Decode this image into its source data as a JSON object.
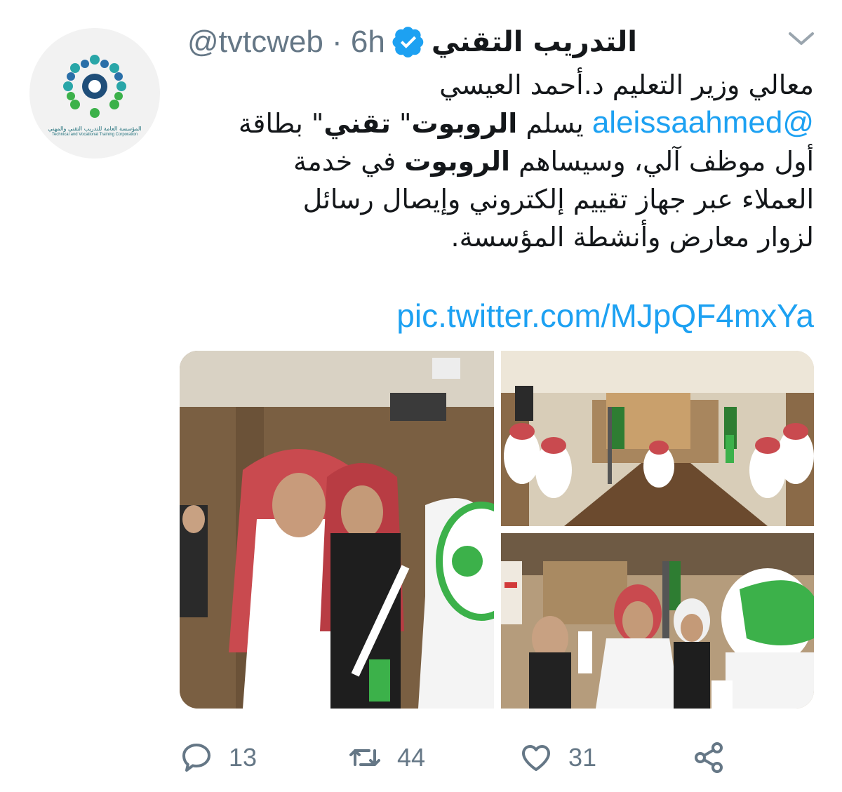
{
  "account": {
    "display_name": "التدريب التقني",
    "handle": "@tvtcweb",
    "separator": "·",
    "time": "6h",
    "verified": true,
    "avatar_org_name_ar": "المؤسسة العامة للتدريب التقني والمهني",
    "avatar_org_name_en": "Technical and Vocational Training Corporation"
  },
  "tweet": {
    "line1": "معالي وزير التعليم د.أحمد العيسي",
    "line2_mention": "@aleissaahmed",
    "line2_a": " يسلم ",
    "line2_bold1": "الروبوت",
    "line2_b": "\" ",
    "line2_bold2": "تقني",
    "line2_c": "\" بطاقة",
    "line3_a": "أول موظف آلي، وسيساهم ",
    "line3_bold": "الروبوت",
    "line3_b": " في خدمة",
    "line4": "العملاء عبر جهاز تقييم إلكتروني وإيصال رسائل",
    "line5": "لزوار معارض وأنشطة المؤسسة.",
    "link": "pic.twitter.com/MJpQF4mxYa"
  },
  "media": {
    "photos": [
      "photo-robot-handover",
      "photo-meeting-room",
      "photo-group-with-robot"
    ]
  },
  "actions": {
    "reply_count": "13",
    "retweet_count": "44",
    "like_count": "31"
  },
  "colors": {
    "link": "#1da1f2",
    "verified": "#1da1f2",
    "muted": "#657786",
    "robot_green": "#3cb14a"
  },
  "icons": [
    "chevron-down-icon",
    "verified-badge-icon",
    "reply-icon",
    "retweet-icon",
    "like-icon",
    "share-icon"
  ]
}
